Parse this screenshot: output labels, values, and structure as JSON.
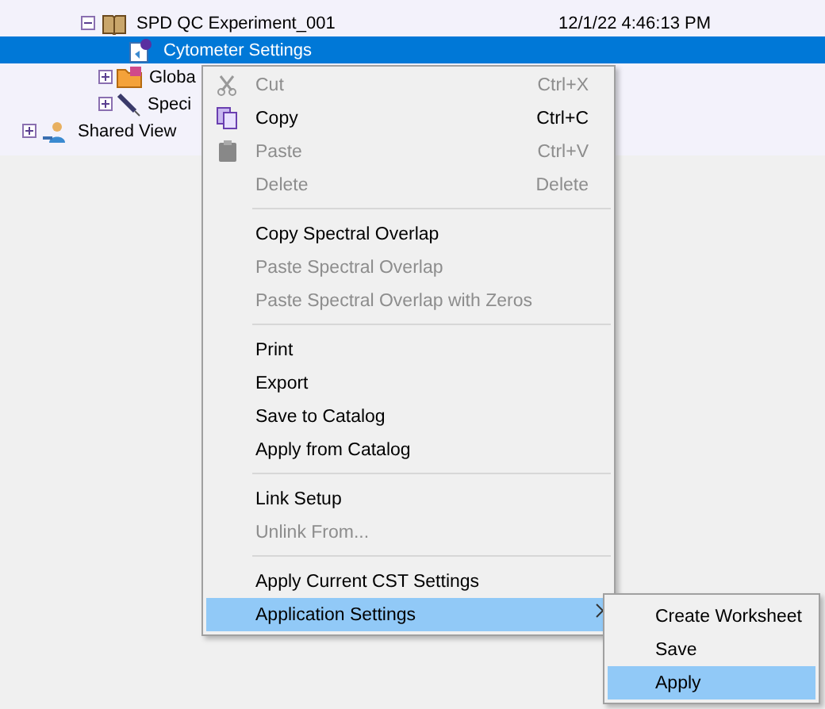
{
  "tree": {
    "items": [
      {
        "label": "SPD QC Experiment_001",
        "date": "12/1/22 4:46:13 PM",
        "expanded": true,
        "selected": false,
        "children": [
          {
            "label": "Cytometer Settings",
            "selected": true
          },
          {
            "label": "Globa",
            "selected": false,
            "expanded": false
          },
          {
            "label": "Speci",
            "selected": false,
            "expanded": false
          }
        ]
      }
    ],
    "root_items": [
      {
        "label": "Shared View",
        "selected": false,
        "expanded": false
      }
    ]
  },
  "context_menu": {
    "items": [
      {
        "kind": "item",
        "label": "Cut",
        "shortcut": "Ctrl+X",
        "disabled": true,
        "selected": false
      },
      {
        "kind": "item",
        "label": "Copy",
        "shortcut": "Ctrl+C",
        "disabled": false,
        "selected": false
      },
      {
        "kind": "item",
        "label": "Paste",
        "shortcut": "Ctrl+V",
        "disabled": true,
        "selected": false
      },
      {
        "kind": "item",
        "label": "Delete",
        "shortcut": "Delete",
        "disabled": true,
        "selected": false
      },
      {
        "kind": "separator"
      },
      {
        "kind": "item",
        "label": "Copy Spectral Overlap",
        "disabled": false,
        "selected": false
      },
      {
        "kind": "item",
        "label": "Paste Spectral Overlap",
        "disabled": true,
        "selected": false
      },
      {
        "kind": "item",
        "label": "Paste Spectral Overlap with Zeros",
        "disabled": true,
        "selected": false
      },
      {
        "kind": "separator"
      },
      {
        "kind": "item",
        "label": "Print",
        "disabled": false,
        "selected": false
      },
      {
        "kind": "item",
        "label": "Export",
        "disabled": false,
        "selected": false
      },
      {
        "kind": "item",
        "label": "Save to Catalog",
        "disabled": false,
        "selected": false
      },
      {
        "kind": "item",
        "label": "Apply from Catalog",
        "disabled": false,
        "selected": false
      },
      {
        "kind": "separator"
      },
      {
        "kind": "item",
        "label": "Link Setup",
        "disabled": false,
        "selected": false
      },
      {
        "kind": "item",
        "label": "Unlink From...",
        "disabled": true,
        "selected": false
      },
      {
        "kind": "separator"
      },
      {
        "kind": "item",
        "label": "Apply Current CST Settings",
        "disabled": false,
        "selected": false
      },
      {
        "kind": "submenu",
        "label": "Application Settings",
        "disabled": false,
        "selected": true
      }
    ]
  },
  "submenu": {
    "items": [
      {
        "label": "Create Worksheet",
        "selected": false
      },
      {
        "label": "Save",
        "selected": false
      },
      {
        "label": "Apply",
        "selected": true
      }
    ]
  }
}
